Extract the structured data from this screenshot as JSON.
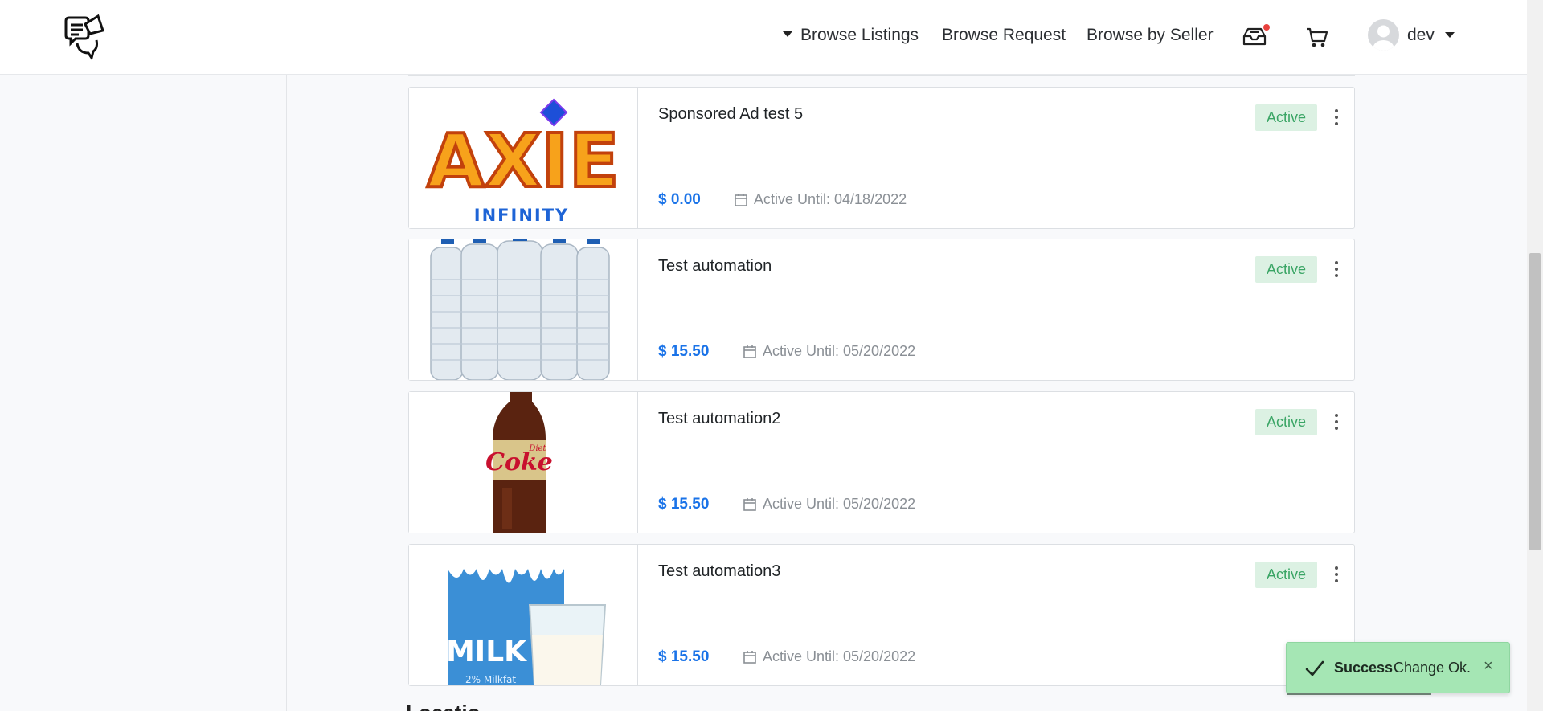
{
  "header": {
    "nav": {
      "browse_listings": "Browse Listings",
      "browse_request": "Browse Request",
      "browse_by_seller": "Browse by Seller"
    },
    "user": {
      "name": "dev"
    },
    "icons": {
      "logo": "megaphone-chat-icon",
      "inbox": "inbox-tray-icon",
      "cart": "cart-icon"
    }
  },
  "listings": [
    {
      "title": "Sponsored Ad test 5",
      "price": "$ 0.00",
      "until": "Active Until: 04/18/2022",
      "status": "Active",
      "image": "axie-infinity-logo"
    },
    {
      "title": "Test automation",
      "price": "$ 15.50",
      "until": "Active Until: 05/20/2022",
      "status": "Active",
      "image": "water-bottles"
    },
    {
      "title": "Test automation2",
      "price": "$ 15.50",
      "until": "Active Until: 05/20/2022",
      "status": "Active",
      "image": "coke-bottle"
    },
    {
      "title": "Test automation3",
      "price": "$ 15.50",
      "until": "Active Until: 05/20/2022",
      "status": "Active",
      "image": "milk-carton",
      "image_text": {
        "main": "MILK",
        "sub": "2% Milkfat"
      }
    }
  ],
  "axie": {
    "word": "AXIE",
    "sub": "INFINITY"
  },
  "coke": {
    "word": "Coke",
    "diet": "Diet"
  },
  "section_peek": "Locatio",
  "toast": {
    "title": "Success",
    "message": "Change Ok.",
    "close": "×"
  },
  "colors": {
    "price": "#1a73e8",
    "badge_bg": "#dcf1e3",
    "badge_text": "#3aa565",
    "toast_bg": "#a5e6b4",
    "notif_dot": "#e8413d"
  }
}
